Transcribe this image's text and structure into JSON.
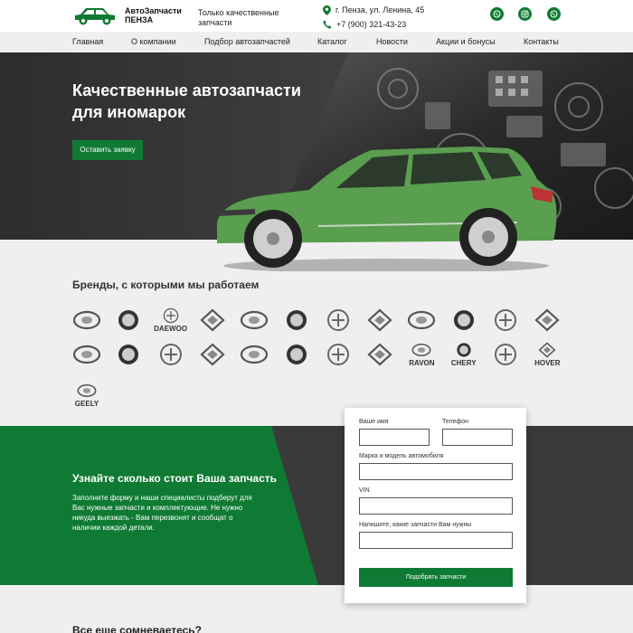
{
  "header": {
    "logo_line1": "АвтоЗапчасти",
    "logo_line2": "ПЕНЗА",
    "tagline": "Только качественные запчасти",
    "address": "г. Пенза, ул. Ленина, 45",
    "phone": "+7 (900) 321-43-23",
    "socials": [
      "whatsapp-icon",
      "instagram-icon",
      "whatsapp-icon"
    ]
  },
  "nav": [
    "Главная",
    "О компании",
    "Подбор автозапчастей",
    "Каталог",
    "Новости",
    "Акции и бонусы",
    "Контакты"
  ],
  "hero": {
    "title": "Качественные автозапчасти для иномарок",
    "button": "Оставить заявку"
  },
  "brands": {
    "title": "Бренды, с которыми мы работаем",
    "row1": [
      {
        "name": "hyundai-logo",
        "label": ""
      },
      {
        "name": "kia-logo",
        "label": ""
      },
      {
        "name": "daewoo-logo",
        "label": "DAEWOO"
      },
      {
        "name": "ssangyong-logo",
        "label": ""
      },
      {
        "name": "toyota-logo",
        "label": ""
      },
      {
        "name": "lexus-logo",
        "label": ""
      },
      {
        "name": "honda-logo",
        "label": ""
      },
      {
        "name": "mazda-logo",
        "label": ""
      },
      {
        "name": "mitsubishi-logo",
        "label": ""
      },
      {
        "name": "nissan-logo",
        "label": ""
      },
      {
        "name": "subaru-logo",
        "label": ""
      },
      {
        "name": "suzuki-logo",
        "label": ""
      }
    ],
    "row2": [
      {
        "name": "audi-logo",
        "label": ""
      },
      {
        "name": "volkswagen-logo",
        "label": ""
      },
      {
        "name": "skoda-logo",
        "label": ""
      },
      {
        "name": "mercedes-logo",
        "label": ""
      },
      {
        "name": "bmw-logo",
        "label": ""
      },
      {
        "name": "renault-logo",
        "label": ""
      },
      {
        "name": "opel-logo",
        "label": ""
      },
      {
        "name": "chevrolet-logo",
        "label": ""
      },
      {
        "name": "ravon-logo",
        "label": "RAVON"
      },
      {
        "name": "chery-logo",
        "label": "CHERY"
      },
      {
        "name": "lifan-logo",
        "label": ""
      },
      {
        "name": "hover-logo",
        "label": "HOVER"
      }
    ],
    "row3": [
      {
        "name": "geely-logo",
        "label": "GEELY"
      }
    ]
  },
  "form": {
    "title": "Узнайте сколько стоит Ваша запчасть",
    "description": "Заполните форму и наши специалисты подберут для Вас нужные запчасти и комплектующие. Не нужно никуда выезжать - Вам перезвонят и сообщат о наличии каждой детали.",
    "name_label": "Ваше имя",
    "phone_label": "Телефон",
    "car_label": "Марка и модель автомобиля",
    "vin_label": "VIN",
    "parts_label": "Напишите, какие запчасти Вам нужны",
    "submit": "Подобрать запчасти"
  },
  "bottom": {
    "title": "Все еще сомневаетесь?"
  },
  "colors": {
    "accent": "#0f7a33",
    "car": "#5a9e4f",
    "dark": "#3a3a3a"
  }
}
